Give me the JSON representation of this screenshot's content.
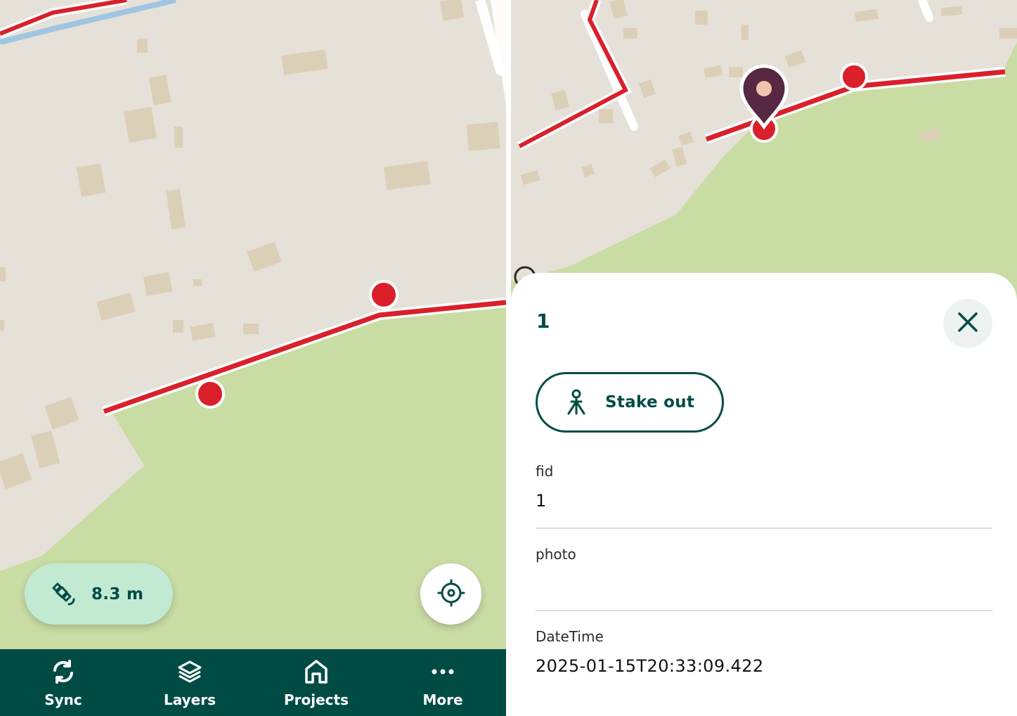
{
  "left_screen": {
    "gps_accuracy": {
      "icon": "satellite-icon",
      "value": "8.3 m"
    },
    "recenter": {
      "icon": "gps-target-icon"
    },
    "bottom_nav": {
      "items": [
        {
          "label": "Sync",
          "icon": "sync-icon"
        },
        {
          "label": "Layers",
          "icon": "layers-icon"
        },
        {
          "label": "Projects",
          "icon": "home-icon"
        },
        {
          "label": "More",
          "icon": "more-dots-icon"
        }
      ]
    }
  },
  "right_screen": {
    "feature_sheet": {
      "title": "1",
      "close_icon": "close-icon",
      "stakeout_button": {
        "label": "Stake out",
        "icon": "survey-tripod-icon"
      },
      "fields": [
        {
          "label": "fid",
          "value": "1"
        },
        {
          "label": "photo",
          "value": ""
        },
        {
          "label": "DateTime",
          "value": "2025-01-15T20:33:09.422"
        }
      ]
    }
  },
  "colors": {
    "brand_dark": "#004c45",
    "accent_light": "#c2ead3",
    "map_land": "#e5e1d8",
    "map_green": "#c9dca4",
    "map_building": "#dccfb8",
    "feature_line": "#d9202b",
    "pin": "#562841",
    "pin_dot": "#f3c2b0"
  }
}
